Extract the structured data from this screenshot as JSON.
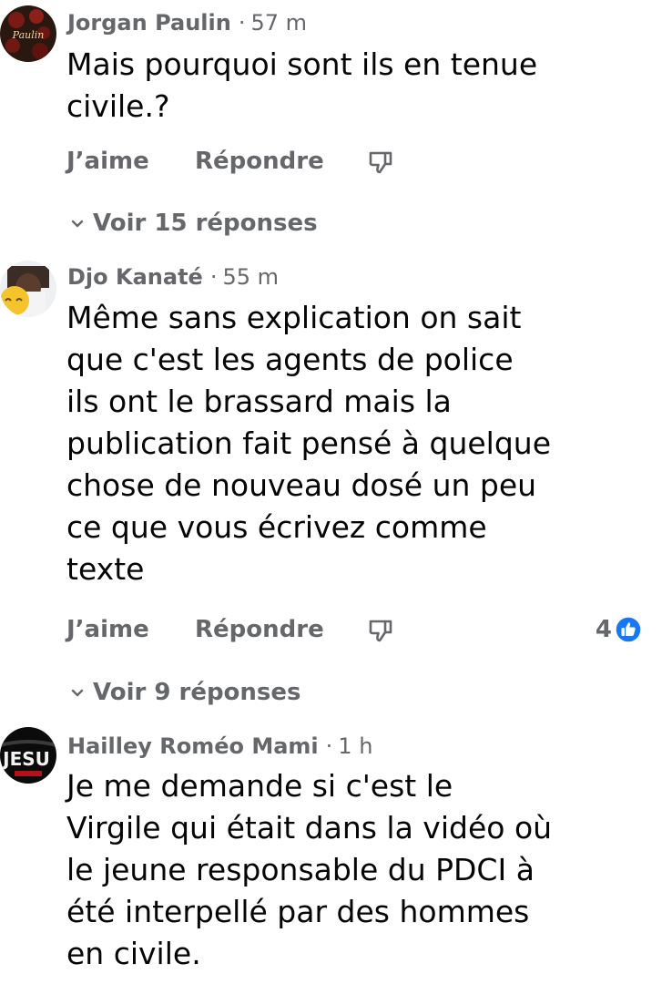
{
  "comments": [
    {
      "author": "Jorgan Paulin",
      "time": "57 m",
      "text": "Mais pourquoi sont ils en tenue\ncivile.?",
      "avatar_text": "Paulin",
      "actions": {
        "like": "J’aime",
        "reply": "Répondre"
      },
      "see_replies": "Voir 15 réponses"
    },
    {
      "author": "Djo Kanaté",
      "time": "55 m",
      "text": "Même sans explication on sait\nque c'est les agents de police\nils ont le brassard mais la\npublication fait pensé à quelque\nchose de nouveau dosé un peu\nce que vous écrivez comme\ntexte",
      "actions": {
        "like": "J’aime",
        "reply": "Répondre"
      },
      "reaction_count": "4",
      "see_replies": "Voir 9 réponses"
    },
    {
      "author": "Hailley Roméo Mami",
      "time": "1 h",
      "text": "Je me demande si c'est le\nVirgile qui était dans la vidéo où\nle jeune responsable du PDCI à\nété interpellé par des hommes\nen civile.",
      "avatar_text": "JESU"
    }
  ],
  "separator": "·",
  "colors": {
    "secondary_text": "#65676b",
    "primary_text": "#050505",
    "like_blue": "#1877f2"
  }
}
